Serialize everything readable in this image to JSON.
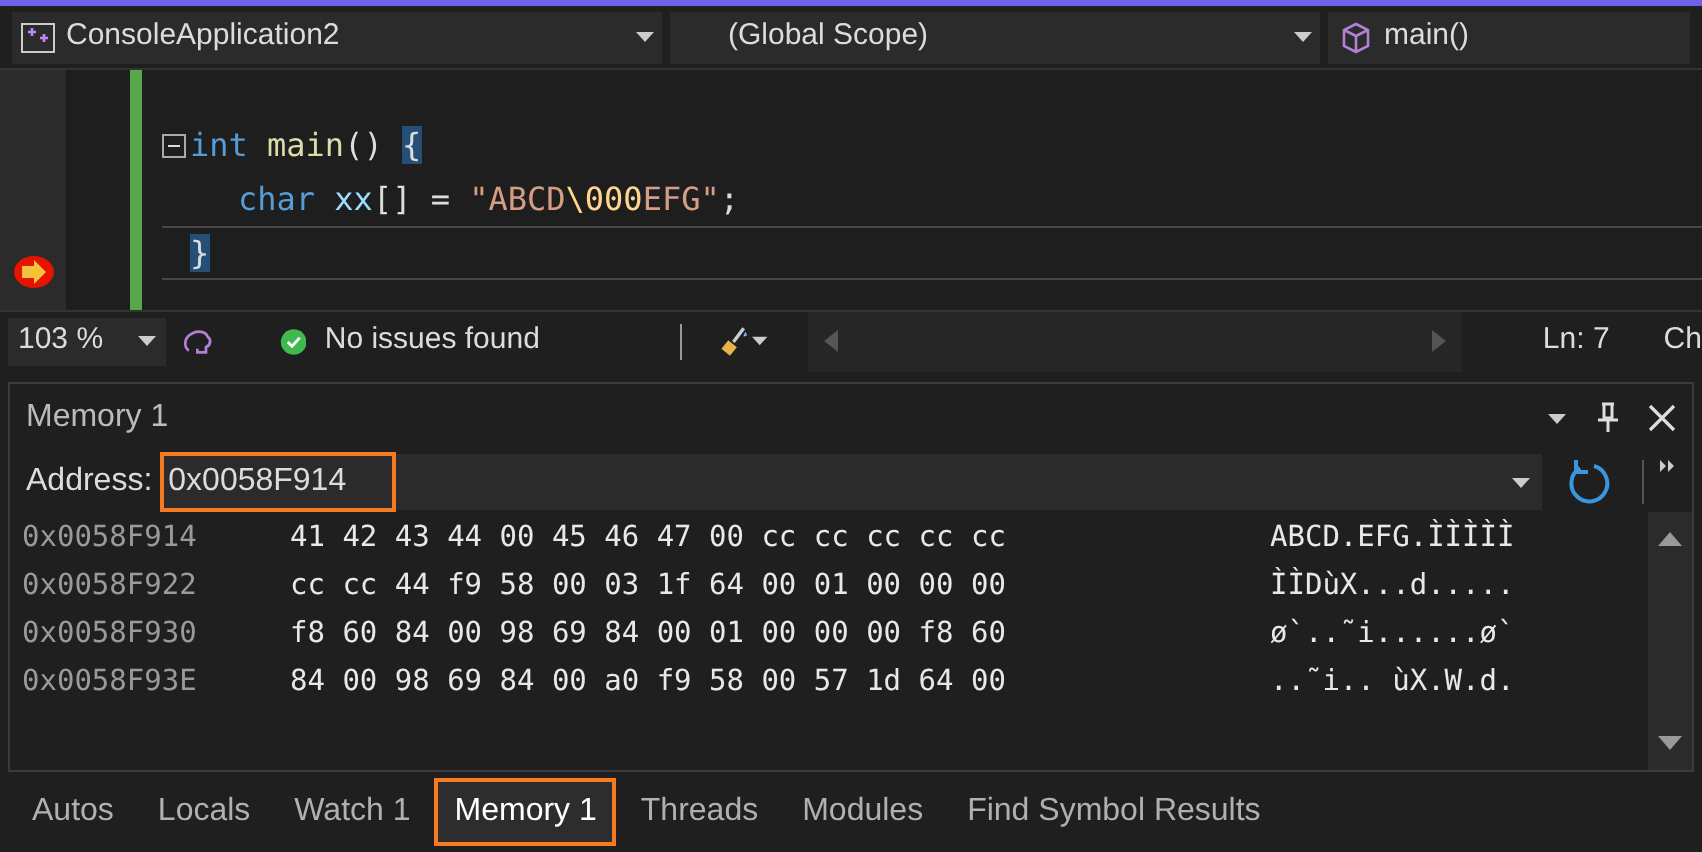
{
  "nav_bar": {
    "project": "ConsoleApplication2",
    "scope": "(Global Scope)",
    "member": "main()"
  },
  "editor": {
    "lines": [
      {
        "tokens": [
          {
            "kind": "keyword",
            "text": "int "
          },
          {
            "kind": "function",
            "text": "main"
          },
          {
            "kind": "plain",
            "text": "() "
          },
          {
            "kind": "brace",
            "text": "{"
          }
        ],
        "collapsible": true,
        "current": false
      },
      {
        "tokens": [
          {
            "kind": "keyword",
            "text": "char "
          },
          {
            "kind": "variable",
            "text": "xx"
          },
          {
            "kind": "plain",
            "text": "[] = "
          },
          {
            "kind": "string",
            "text": "\"ABCD"
          },
          {
            "kind": "escape",
            "text": "\\000"
          },
          {
            "kind": "string",
            "text": "EFG\""
          },
          {
            "kind": "plain",
            "text": ";"
          }
        ],
        "collapsible": false,
        "current": false
      },
      {
        "tokens": [
          {
            "kind": "brace",
            "text": "}"
          }
        ],
        "collapsible": false,
        "current": true
      }
    ]
  },
  "status_bar": {
    "zoom": "103 %",
    "issues": "No issues found",
    "line": "Ln: 7",
    "column": "Ch"
  },
  "memory_window": {
    "title": "Memory 1",
    "address_label": "Address:",
    "address": "0x0058F914",
    "address_highlighted": true,
    "rows": [
      {
        "address": "0x0058F914",
        "bytes": "41 42 43 44 00 45 46 47 00 cc cc cc cc cc",
        "ascii": "ABCD.EFG.ÌÌÌÌÌ"
      },
      {
        "address": "0x0058F922",
        "bytes": "cc cc 44 f9 58 00 03 1f 64 00 01 00 00 00",
        "ascii": "ÌÌDùX...d....."
      },
      {
        "address": "0x0058F930",
        "bytes": "f8 60 84 00 98 69 84 00 01 00 00 00 f8 60",
        "ascii": "ø`..˜i......ø`"
      },
      {
        "address": "0x0058F93E",
        "bytes": "84 00 98 69 84 00 a0 f9 58 00 57 1d 64 00",
        "ascii": "..˜i.. ùX.W.d."
      }
    ]
  },
  "tabs": [
    {
      "label": "Autos",
      "selected": false,
      "highlighted": false
    },
    {
      "label": "Locals",
      "selected": false,
      "highlighted": false
    },
    {
      "label": "Watch 1",
      "selected": false,
      "highlighted": false
    },
    {
      "label": "Memory 1",
      "selected": true,
      "highlighted": true
    },
    {
      "label": "Threads",
      "selected": false,
      "highlighted": false
    },
    {
      "label": "Modules",
      "selected": false,
      "highlighted": false
    },
    {
      "label": "Find Symbol Results",
      "selected": false,
      "highlighted": false
    }
  ]
}
